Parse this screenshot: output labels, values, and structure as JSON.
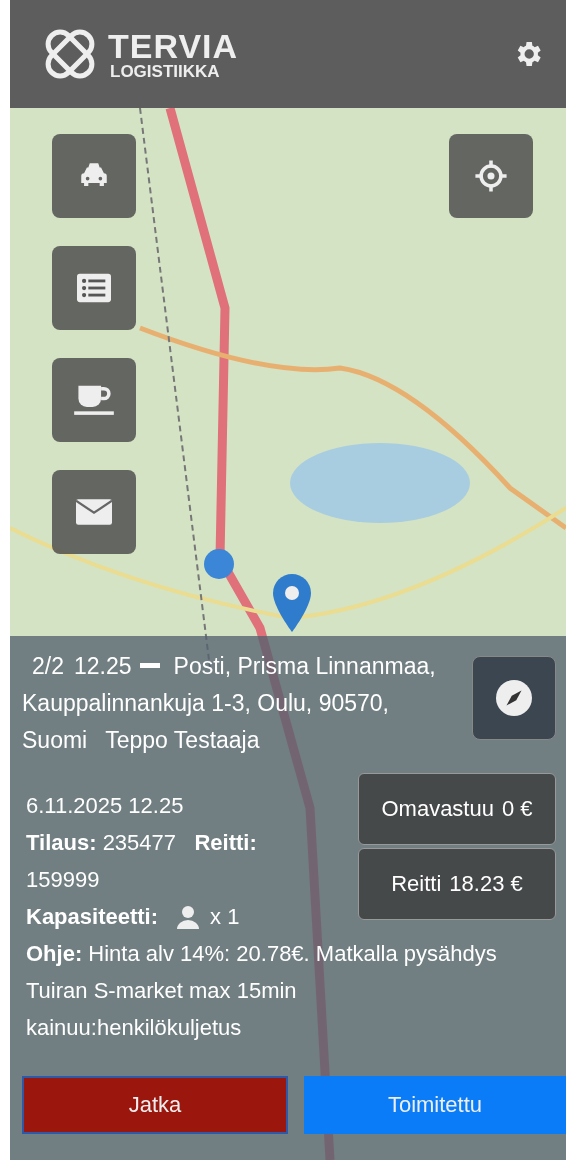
{
  "header": {
    "brand_name": "TERVIA",
    "brand_sub": "LOGISTIIKKA"
  },
  "trip": {
    "sequence": "2/2",
    "time": "12.25",
    "address": "Posti, Prisma Linnanmaa, Kauppalinnankuja 1-3, Oulu, 90570, Suomi",
    "customer": "Teppo Testaaja"
  },
  "details": {
    "datetime": "6.11.2025 12.25",
    "order": "**Tilaus:** 235477",
    "route": "**Reitti:** 159999",
    "capacity_label": "Kapasiteetti:",
    "capacity_count": "x 1",
    "instructions": "**Ohje:** Hinta alv 14%: 20.78€. Matkalla pysähdys Tuiran S-market max 15min\nkainuu:henkilökuljetus"
  },
  "fees": [
    {
      "label": "Omavastuu",
      "value": "0 €"
    },
    {
      "label": "Reitti",
      "value": "18.23 €"
    }
  ],
  "actions": [
    {
      "label": "Jatka",
      "kind": "continue"
    },
    {
      "label": "Toimitettu",
      "kind": "delivered"
    }
  ]
}
